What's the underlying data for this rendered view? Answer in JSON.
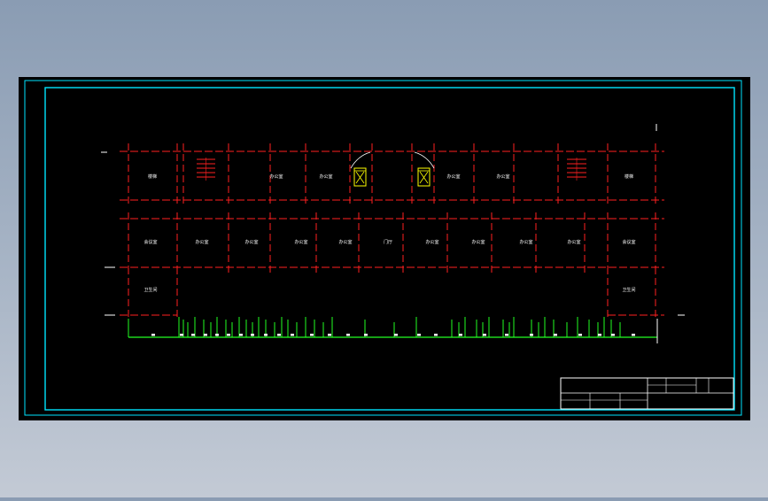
{
  "drawing": {
    "canvas_background": "#000000",
    "frame_color": "#00e5ff",
    "wall_color": "#ff2020",
    "grid_line_color": "#ff2020",
    "elevation_line_color": "#22ff22",
    "elevator_color": "#ffff00",
    "title_block_color": "#ffffff",
    "window_line_color": "#ffffff",
    "rooms_top_row": [
      "楼梯",
      "办公室",
      "办公室",
      "办公室",
      "办公室",
      "楼梯"
    ],
    "rooms_middle_row": [
      "会议室",
      "办公室",
      "办公室",
      "办公室",
      "办公室",
      "门厅",
      "办公室",
      "办公室",
      "办公室",
      "办公室",
      "会议室"
    ],
    "rooms_bottom_row": [
      "卫生间",
      "卫生间"
    ]
  }
}
